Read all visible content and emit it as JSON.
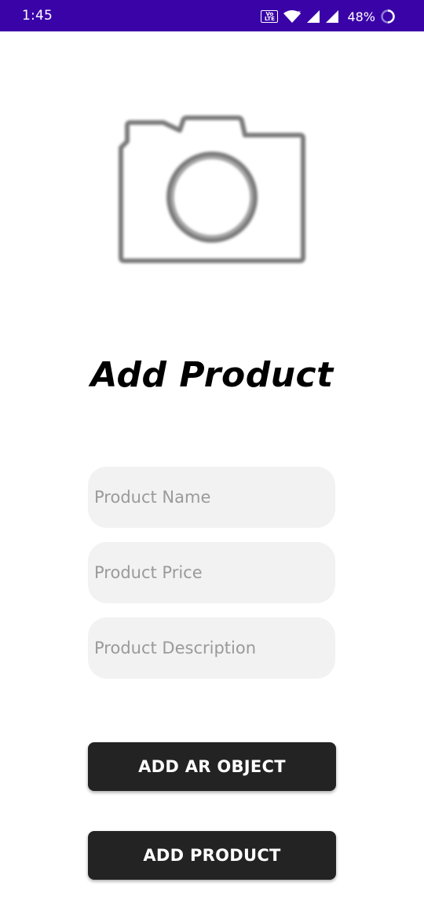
{
  "status_bar": {
    "time": "1:45",
    "volte_label": "Vo LTE",
    "battery_percent": "48%",
    "background_color": "#3a03a8"
  },
  "icons": {
    "product_image": "camera-icon"
  },
  "page": {
    "title": "Add Product"
  },
  "form": {
    "product_name_placeholder": "Product Name",
    "product_name_value": "",
    "product_price_placeholder": "Product Price",
    "product_price_value": "",
    "product_description_placeholder": "Product Description",
    "product_description_value": ""
  },
  "buttons": {
    "add_ar_object_label": "ADD AR OBJECT",
    "add_product_label": "ADD PRODUCT",
    "button_color": "#232323"
  }
}
